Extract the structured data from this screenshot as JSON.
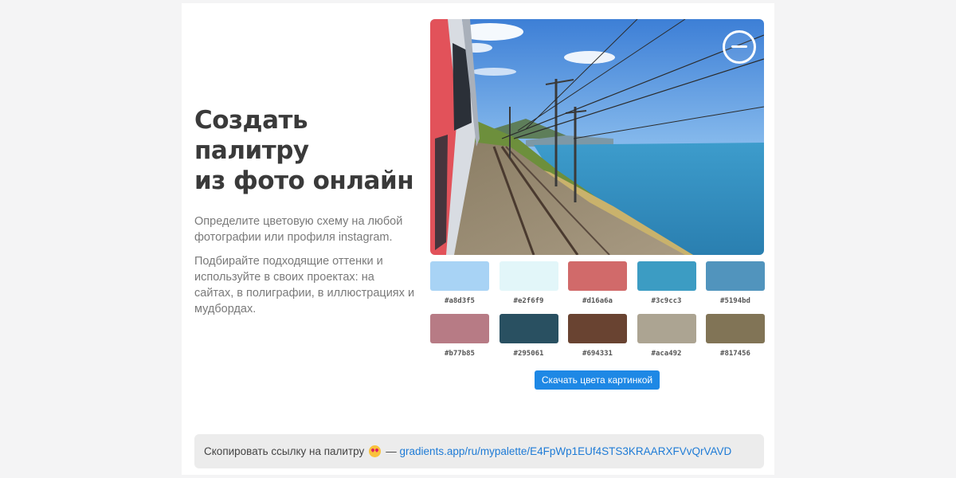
{
  "hero": {
    "title_line1": "Создать палитру",
    "title_line2": "из фото онлайн",
    "desc1": "Определите цветовую схему на любой фотографии или профиля instagram.",
    "desc2": "Подбирайте подходящие оттенки и используйте в своих проектах: на сайтах, в полиграфии, в иллюстрациях и мудбордах."
  },
  "photo": {
    "zoom_icon": "zoom-out-icon"
  },
  "palette": [
    {
      "hex": "#a8d3f5",
      "label": "#a8d3f5"
    },
    {
      "hex": "#e2f6f9",
      "label": "#e2f6f9"
    },
    {
      "hex": "#d16a6a",
      "label": "#d16a6a"
    },
    {
      "hex": "#3c9cc3",
      "label": "#3c9cc3"
    },
    {
      "hex": "#5194bd",
      "label": "#5194bd"
    },
    {
      "hex": "#b77b85",
      "label": "#b77b85"
    },
    {
      "hex": "#295061",
      "label": "#295061"
    },
    {
      "hex": "#694331",
      "label": "#694331"
    },
    {
      "hex": "#aca492",
      "label": "#aca492"
    },
    {
      "hex": "#817456",
      "label": "#817456"
    }
  ],
  "download_button": "Скачать цвета картинкой",
  "share": {
    "text": "Скопировать ссылку на палитру",
    "emoji_icon": "star-struck-emoji-icon",
    "dash": "—",
    "link": "gradients.app/ru/mypalette/E4FpWp1EUf4STS3KRAARXFVvQrVAVD"
  },
  "colors": {
    "page_bg": "#f4f4f5",
    "button": "#1e88e5",
    "link": "#1e7bd6"
  }
}
